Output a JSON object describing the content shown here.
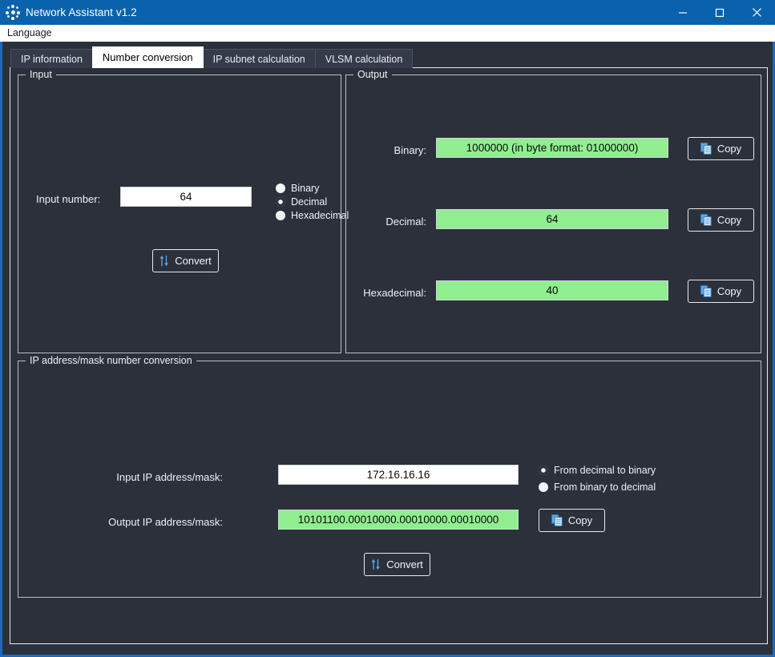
{
  "window": {
    "title": "Network Assistant v1.2",
    "app_icon": "network-hub-icon",
    "titlebar_color": "#0a62ac",
    "background_color": "#2b303b",
    "accent_border_color": "#1d6bb8",
    "controls": {
      "minimize": "minimize-icon",
      "maximize": "maximize-icon",
      "close": "close-icon"
    }
  },
  "menubar": {
    "items": [
      {
        "label": "Language"
      }
    ]
  },
  "tabs": [
    {
      "label": "IP information",
      "active": false
    },
    {
      "label": "Number conversion",
      "active": true
    },
    {
      "label": "IP subnet calculation",
      "active": false
    },
    {
      "label": "VLSM calculation",
      "active": false
    }
  ],
  "input_group": {
    "legend": "Input",
    "input_number_label": "Input number:",
    "input_number_value": "64",
    "input_number_placeholder": "",
    "base_options": [
      {
        "label": "Binary",
        "selected": false
      },
      {
        "label": "Decimal",
        "selected": true
      },
      {
        "label": "Hexadecimal",
        "selected": false
      }
    ],
    "convert_label": "Convert",
    "convert_icon": "up-down-arrows-icon"
  },
  "output_group": {
    "legend": "Output",
    "copy_label": "Copy",
    "copy_icon": "copy-icon",
    "field_color": "#90ee90",
    "rows": [
      {
        "label": "Binary:",
        "value": "1000000 (in byte format: 01000000)"
      },
      {
        "label": "Decimal:",
        "value": "64"
      },
      {
        "label": "Hexadecimal:",
        "value": "40"
      }
    ]
  },
  "ipmask_group": {
    "legend": "IP address/mask number conversion",
    "input_label": "Input IP address/mask:",
    "input_value": "172.16.16.16",
    "input_placeholder": "",
    "output_label": "Output IP address/mask:",
    "output_value": "10101100.00010000.00010000.00010000",
    "direction_options": [
      {
        "label": "From decimal to binary",
        "selected": true
      },
      {
        "label": "From binary to decimal",
        "selected": false
      }
    ],
    "copy_label": "Copy",
    "copy_icon": "copy-icon",
    "convert_label": "Convert",
    "convert_icon": "up-down-arrows-icon"
  }
}
